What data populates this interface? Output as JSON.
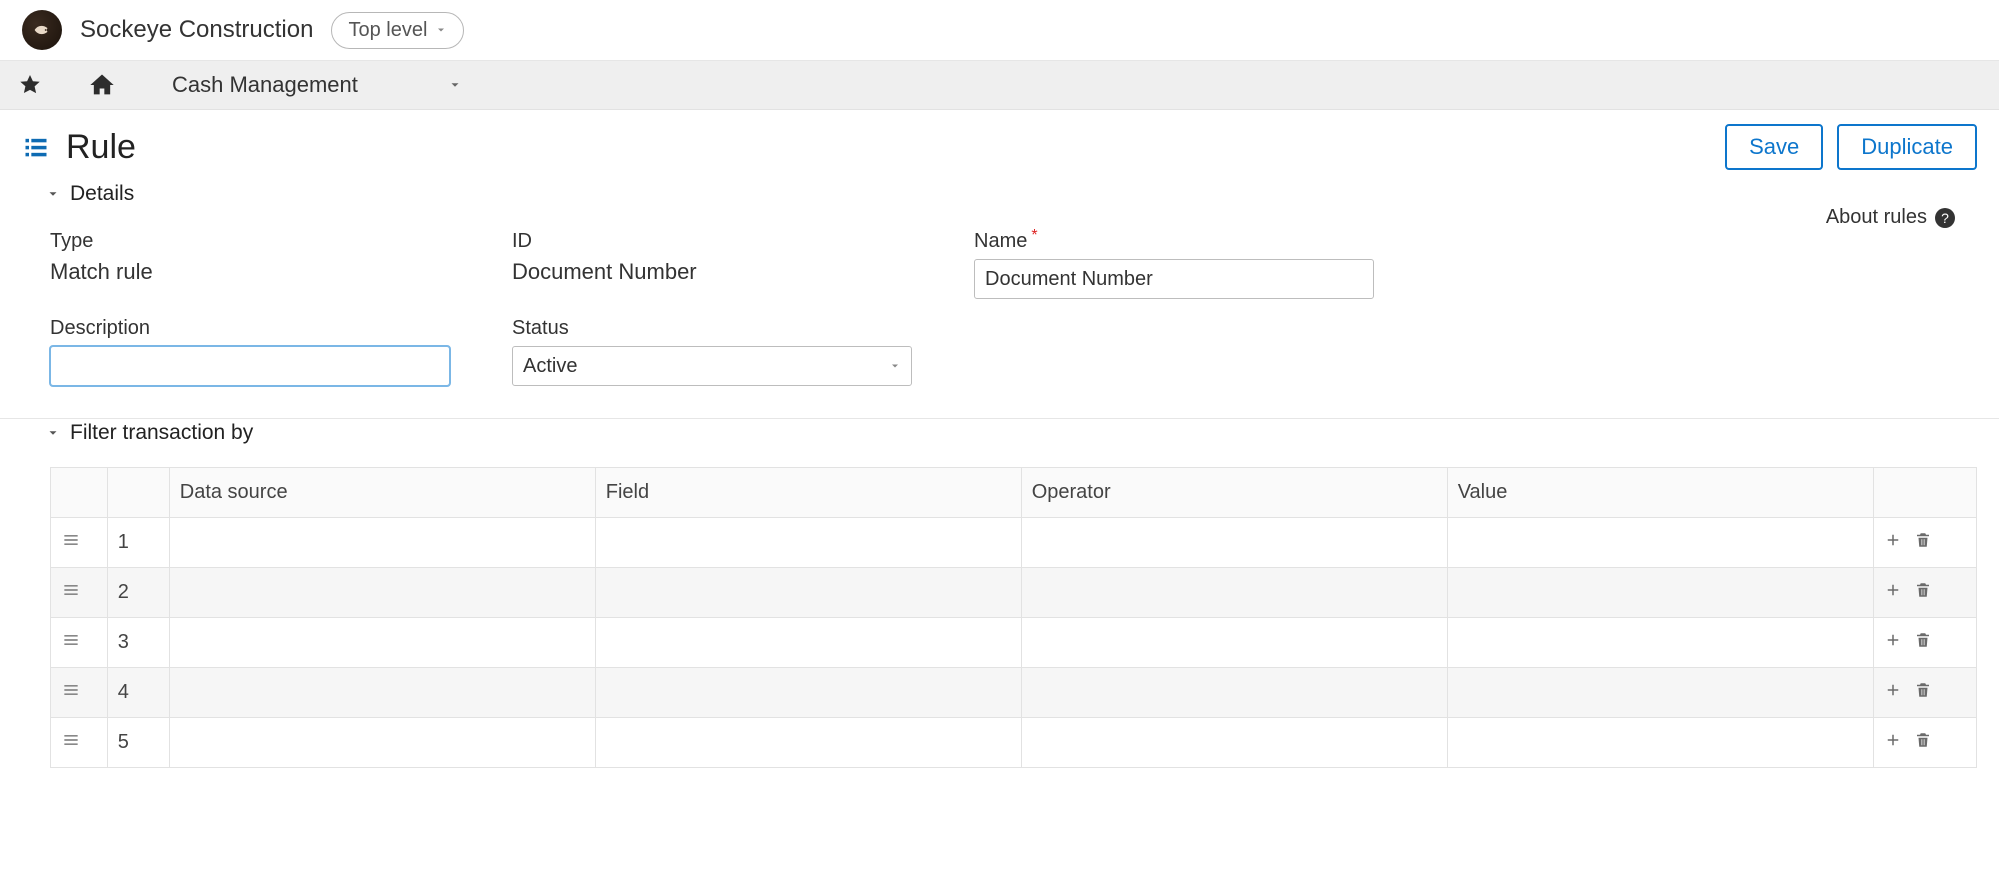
{
  "brand": {
    "company": "Sockeye Construction",
    "level_selector_label": "Top level"
  },
  "nav": {
    "module": "Cash Management"
  },
  "page": {
    "title": "Rule",
    "save_label": "Save",
    "duplicate_label": "Duplicate",
    "about_rules_label": "About rules"
  },
  "sections": {
    "details_title": "Details",
    "filter_title": "Filter transaction by"
  },
  "fields": {
    "type_label": "Type",
    "type_value": "Match rule",
    "id_label": "ID",
    "id_value": "Document Number",
    "name_label": "Name",
    "name_value": "Document Number",
    "description_label": "Description",
    "description_value": "",
    "status_label": "Status",
    "status_value": "Active"
  },
  "filter_table": {
    "headers": {
      "data_source": "Data source",
      "field": "Field",
      "operator": "Operator",
      "value": "Value"
    },
    "rows": [
      {
        "num": "1"
      },
      {
        "num": "2"
      },
      {
        "num": "3"
      },
      {
        "num": "4"
      },
      {
        "num": "5"
      }
    ]
  }
}
